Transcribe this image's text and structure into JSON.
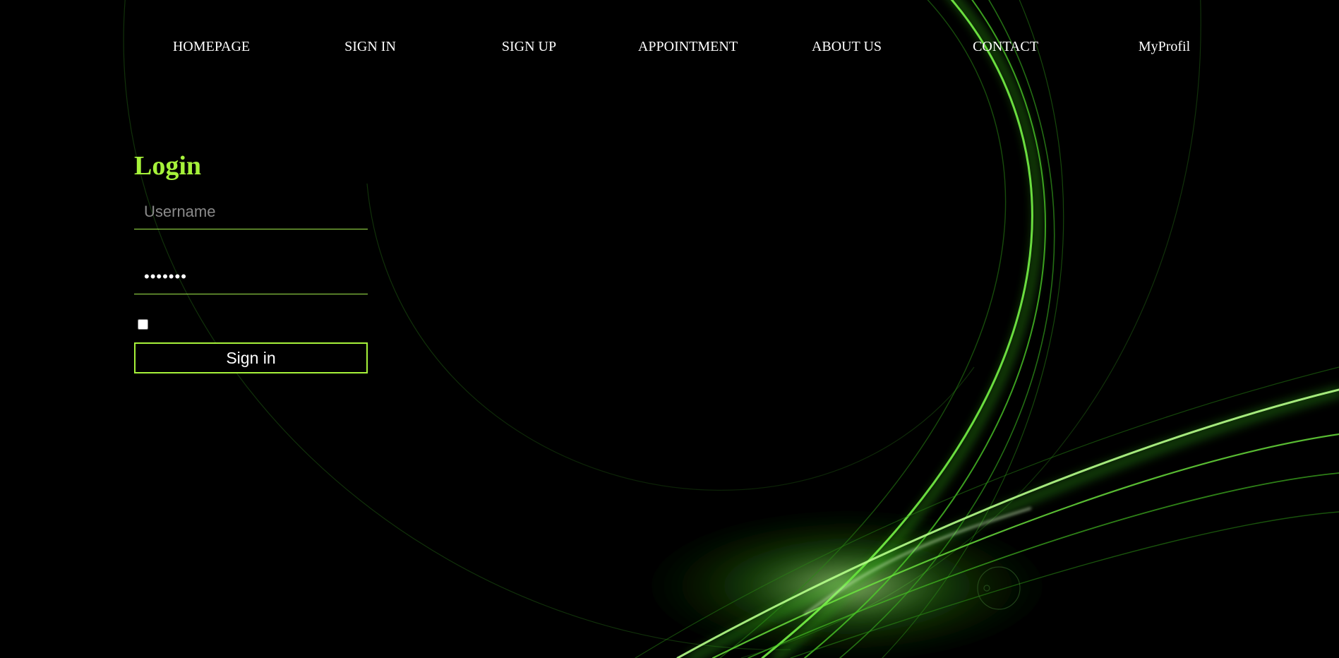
{
  "colors": {
    "background": "#000000",
    "accent": "#a6f23a",
    "nav_text": "#ffffff",
    "field_underline": "#9fe84a",
    "placeholder": "#8a8a8a",
    "glow": "#5cff2e"
  },
  "nav": {
    "items": [
      {
        "label": "HOMEPAGE"
      },
      {
        "label": "SIGN IN"
      },
      {
        "label": "SIGN UP"
      },
      {
        "label": "APPOINTMENT"
      },
      {
        "label": "ABOUT US"
      },
      {
        "label": "CONTACT"
      },
      {
        "label": "MyProfil"
      }
    ]
  },
  "login": {
    "title": "Login",
    "username": {
      "placeholder": "Username",
      "value": ""
    },
    "password": {
      "value": "•••••••"
    },
    "remember_checked": false,
    "submit_label": "Sign in"
  }
}
